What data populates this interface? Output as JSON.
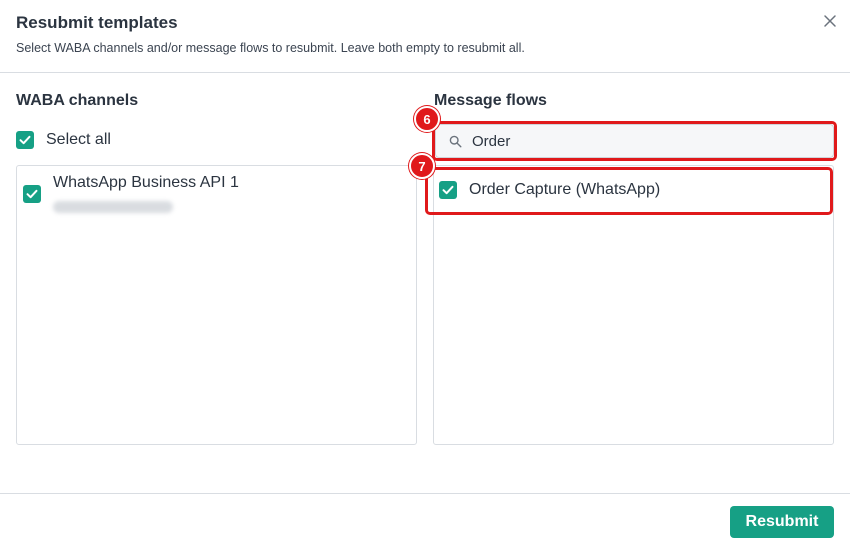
{
  "dialog": {
    "title": "Resubmit templates",
    "subtitle": "Select WABA channels and/or message flows to resubmit. Leave both empty to resubmit all."
  },
  "waba": {
    "label": "WABA channels",
    "select_all_label": "Select all",
    "select_all_checked": true,
    "channels": [
      {
        "name": "WhatsApp Business API 1",
        "checked": true
      }
    ]
  },
  "flows": {
    "label": "Message flows",
    "search_value": "Order",
    "items": [
      {
        "name": "Order Capture (WhatsApp)",
        "checked": true
      }
    ]
  },
  "annotations": {
    "badge_search": "6",
    "badge_flow": "7"
  },
  "footer": {
    "resubmit_label": "Resubmit"
  },
  "colors": {
    "accent": "#16a085",
    "highlight": "#e0191b"
  },
  "icons": {
    "close": "close-icon",
    "search": "search-icon",
    "check": "checkmark-icon"
  }
}
